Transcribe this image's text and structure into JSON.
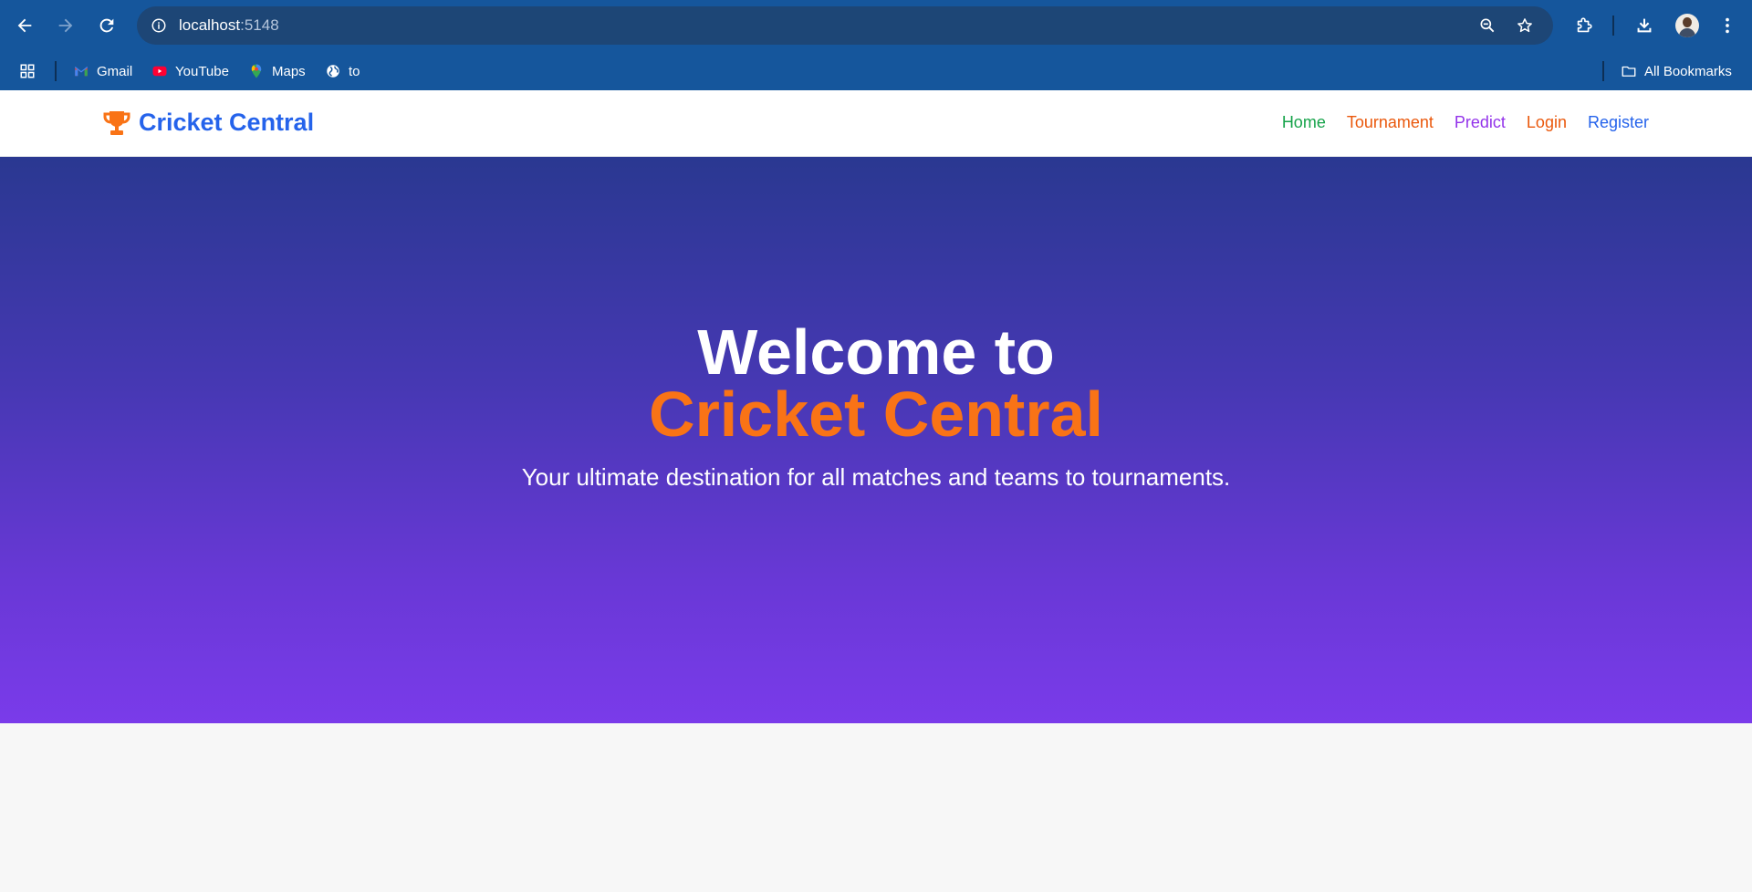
{
  "browser": {
    "url_host": "localhost",
    "url_port": ":5148",
    "bookmarks": [
      {
        "label": "Gmail",
        "icon": "gmail-icon"
      },
      {
        "label": "YouTube",
        "icon": "youtube-icon"
      },
      {
        "label": "Maps",
        "icon": "maps-icon"
      },
      {
        "label": "to",
        "icon": "globe-icon"
      }
    ],
    "all_bookmarks_label": "All Bookmarks",
    "colors": {
      "frame": "#15569c",
      "omnibox": "#1d4676"
    }
  },
  "navbar": {
    "brand": "Cricket Central",
    "brand_icon": "trophy-icon",
    "links": [
      {
        "label": "Home",
        "color": "#16a34a"
      },
      {
        "label": "Tournament",
        "color": "#ea580c"
      },
      {
        "label": "Predict",
        "color": "#9333ea"
      },
      {
        "label": "Login",
        "color": "#ea580c"
      },
      {
        "label": "Register",
        "color": "#2563eb"
      }
    ]
  },
  "hero": {
    "title_line1": "Welcome to",
    "title_line2": "Cricket Central",
    "subtitle": "Your ultimate destination for all matches and teams to tournaments.",
    "colors": {
      "accent": "#f97316",
      "gradient_top": "#2a3891",
      "gradient_bottom": "#7a3bea"
    }
  }
}
